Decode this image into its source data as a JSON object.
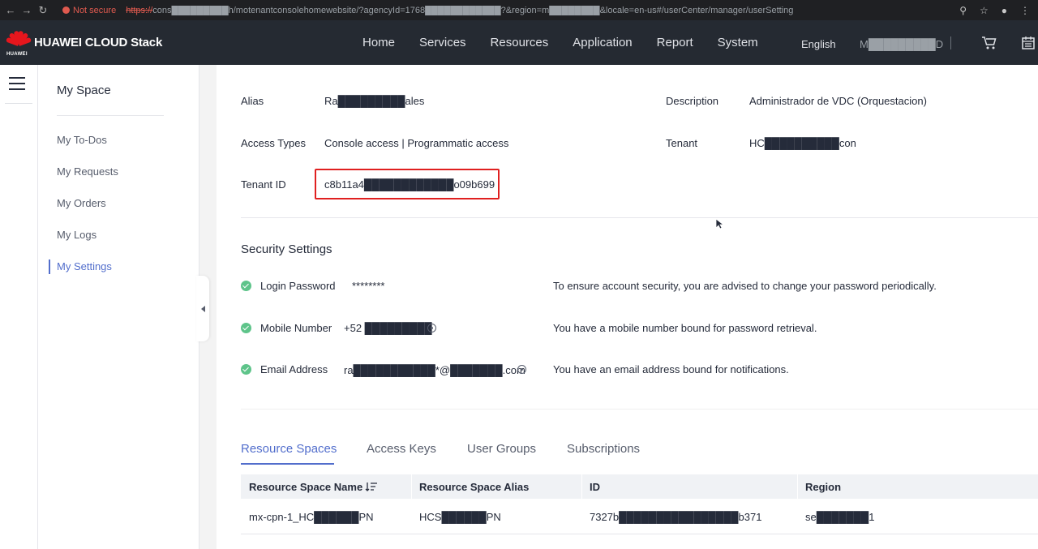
{
  "browser": {
    "security_label": "Not secure",
    "url_scheme": "https://",
    "url_rest": "cons█████████h/motenantconsolehomewebsite/?agencyId=1768████████████?&region=m████████&locale=en-us#/userCenter/manager/userSetting"
  },
  "header": {
    "brand": "HUAWEI CLOUD Stack",
    "brand_sub": "HUAWEI",
    "nav": [
      "Home",
      "Services",
      "Resources",
      "Application",
      "Report",
      "System"
    ],
    "language": "English",
    "user": "M█████████D"
  },
  "sidebar": {
    "title": "My Space",
    "items": [
      {
        "label": "My To-Dos"
      },
      {
        "label": "My Requests"
      },
      {
        "label": "My Orders"
      },
      {
        "label": "My Logs"
      },
      {
        "label": "My Settings"
      }
    ]
  },
  "profile": {
    "alias_label": "Alias",
    "alias_value": "Ra█████████ales",
    "description_label": "Description",
    "description_value": "Administrador de VDC (Orquestacion)",
    "access_types_label": "Access Types",
    "access_types_value": "Console access | Programmatic access",
    "tenant_label": "Tenant",
    "tenant_value": "HC██████████con",
    "tenant_id_label": "Tenant ID",
    "tenant_id_value": "c8b11a4████████████o09b699"
  },
  "security": {
    "title": "Security Settings",
    "rows": [
      {
        "label": "Login Password",
        "value": "********",
        "hint": "To ensure account security, you are advised to change your password periodically."
      },
      {
        "label": "Mobile Number",
        "value": "+52 █████████",
        "hint": "You have a mobile number bound for password retrieval."
      },
      {
        "label": "Email Address",
        "value": "ra███████████*@███████.com",
        "hint": "You have an email address bound for notifications."
      }
    ]
  },
  "tabs": [
    "Resource Spaces",
    "Access Keys",
    "User Groups",
    "Subscriptions"
  ],
  "table": {
    "columns": [
      "Resource Space Name",
      "Resource Space Alias",
      "ID",
      "Region"
    ],
    "rows": [
      [
        "mx-cpn-1_HC██████PN",
        "HCS██████PN",
        "7327b████████████████b371",
        "se███████1"
      ]
    ]
  },
  "colors": {
    "accent": "#526ecc",
    "header_bg": "#252a32",
    "success": "#5ec48a",
    "highlight_box": "#e02020"
  }
}
